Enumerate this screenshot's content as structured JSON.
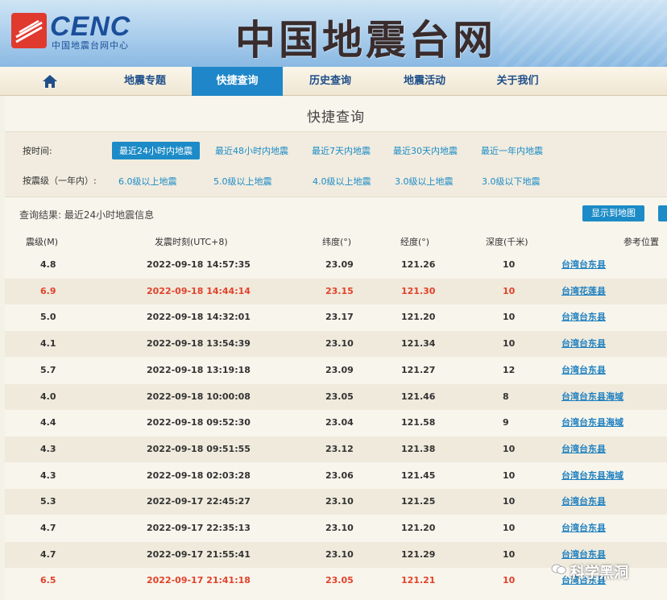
{
  "header": {
    "logo_text": "CENC",
    "logo_subtitle": "中国地震台网中心",
    "site_title": "中国地震台网"
  },
  "nav": {
    "items": [
      {
        "label": "地震专题",
        "active": false
      },
      {
        "label": "快捷查询",
        "active": true
      },
      {
        "label": "历史查询",
        "active": false
      },
      {
        "label": "地震活动",
        "active": false
      },
      {
        "label": "关于我们",
        "active": false
      }
    ]
  },
  "panel": {
    "title": "快捷查询",
    "by_time_label": "按时间:",
    "time_filters": [
      "最近24小时内地震",
      "最近48小时内地震",
      "最近7天内地震",
      "最近30天内地震",
      "最近一年内地震"
    ],
    "by_magnitude_label": "按震级（一年内）:",
    "magnitude_filters": [
      "6.0级以上地震",
      "5.0级以上地震",
      "4.0级以上地震",
      "3.0级以上地震",
      "3.0级以下地震"
    ],
    "result_label": "查询结果:  最近24小时地震信息",
    "map_button": "显示到地图"
  },
  "table": {
    "headers": [
      "震级(M)",
      "发震时刻(UTC+8)",
      "纬度(°)",
      "经度(°)",
      "深度(千米)",
      "参考位置"
    ],
    "rows": [
      {
        "mag": "4.8",
        "time": "2022-09-18 14:57:35",
        "lat": "23.09",
        "lon": "121.26",
        "depth": "10",
        "loc": "台湾台东县",
        "highlight": false
      },
      {
        "mag": "6.9",
        "time": "2022-09-18 14:44:14",
        "lat": "23.15",
        "lon": "121.30",
        "depth": "10",
        "loc": "台湾花莲县",
        "highlight": true
      },
      {
        "mag": "5.0",
        "time": "2022-09-18 14:32:01",
        "lat": "23.17",
        "lon": "121.20",
        "depth": "10",
        "loc": "台湾台东县",
        "highlight": false
      },
      {
        "mag": "4.1",
        "time": "2022-09-18 13:54:39",
        "lat": "23.10",
        "lon": "121.34",
        "depth": "10",
        "loc": "台湾台东县",
        "highlight": false
      },
      {
        "mag": "5.7",
        "time": "2022-09-18 13:19:18",
        "lat": "23.09",
        "lon": "121.27",
        "depth": "12",
        "loc": "台湾台东县",
        "highlight": false
      },
      {
        "mag": "4.0",
        "time": "2022-09-18 10:00:08",
        "lat": "23.05",
        "lon": "121.46",
        "depth": "8",
        "loc": "台湾台东县海域",
        "highlight": false
      },
      {
        "mag": "4.4",
        "time": "2022-09-18 09:52:30",
        "lat": "23.04",
        "lon": "121.58",
        "depth": "9",
        "loc": "台湾台东县海域",
        "highlight": false
      },
      {
        "mag": "4.3",
        "time": "2022-09-18 09:51:55",
        "lat": "23.12",
        "lon": "121.38",
        "depth": "10",
        "loc": "台湾台东县",
        "highlight": false
      },
      {
        "mag": "4.3",
        "time": "2022-09-18 02:03:28",
        "lat": "23.06",
        "lon": "121.45",
        "depth": "10",
        "loc": "台湾台东县海域",
        "highlight": false
      },
      {
        "mag": "5.3",
        "time": "2022-09-17 22:45:27",
        "lat": "23.10",
        "lon": "121.25",
        "depth": "10",
        "loc": "台湾台东县",
        "highlight": false
      },
      {
        "mag": "4.7",
        "time": "2022-09-17 22:35:13",
        "lat": "23.10",
        "lon": "121.20",
        "depth": "10",
        "loc": "台湾台东县",
        "highlight": false
      },
      {
        "mag": "4.7",
        "time": "2022-09-17 21:55:41",
        "lat": "23.10",
        "lon": "121.29",
        "depth": "10",
        "loc": "台湾台东县",
        "highlight": false
      },
      {
        "mag": "6.5",
        "time": "2022-09-17 21:41:18",
        "lat": "23.05",
        "lon": "121.21",
        "depth": "10",
        "loc": "台湾台东县",
        "highlight": true
      }
    ]
  },
  "watermark": "科学黑洞",
  "colors": {
    "accent": "#1c8bc7",
    "highlight_red": "#e2412b",
    "logo_red": "#e03a2f",
    "logo_blue": "#1b4f9a"
  }
}
